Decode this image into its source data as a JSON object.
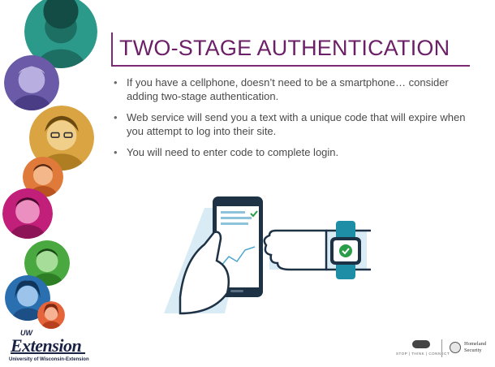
{
  "slide": {
    "title": "TWO-STAGE AUTHENTICATION",
    "bullets": [
      "If you have a cellphone, doesn’t need to be a smartphone… consider adding two-stage authentication.",
      "Web service will send you a text with a unique code that will expire when you attempt to log into their site.",
      "You will need to enter code to complete login."
    ]
  },
  "illustration": {
    "phone_icon": "smartphone-icon",
    "watch_icon": "smartwatch-check-icon",
    "accent": "#1e8ea6"
  },
  "logo": {
    "uw": "UW",
    "name": "Extension",
    "subtitle": "University of Wisconsin-Extension"
  },
  "footer": {
    "stop_think_connect": "STOP | THINK | CONNECT",
    "dhs_line1": "Homeland",
    "dhs_line2": "Security"
  },
  "colors": {
    "title": "#6b1f66",
    "title_rule": "#7b2a73",
    "body_text": "#4a4a4a",
    "logo": "#1a2244"
  }
}
